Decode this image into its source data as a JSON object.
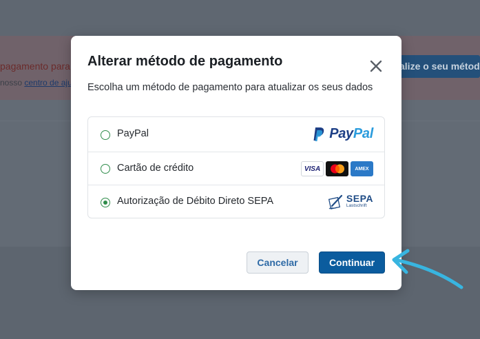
{
  "background": {
    "banner_text": "pagamento para c",
    "banner_link_prefix": "nosso ",
    "banner_link": "centro de aju",
    "banner_button": "alize o seu método"
  },
  "modal": {
    "title": "Alterar método de pagamento",
    "subtitle": "Escolha um método de pagamento para atualizar os seus dados",
    "close_icon": "close-icon",
    "options": [
      {
        "label": "PayPal",
        "selected": false,
        "logo": "paypal-logo",
        "logo_text_a": "Pay",
        "logo_text_b": "Pal"
      },
      {
        "label": "Cartão de crédito",
        "selected": false,
        "logos": [
          "VISA",
          "mastercard",
          "AMEX"
        ]
      },
      {
        "label": "Autorização de Débito Direto SEPA",
        "selected": true,
        "logo": "sepa-logo",
        "logo_text": "SEPA",
        "logo_subtext": "Lastschrift"
      }
    ],
    "cancel_label": "Cancelar",
    "continue_label": "Continuar"
  },
  "colors": {
    "radio_accent": "#2f8c4a",
    "primary_button": "#0b5c9e",
    "annotation_arrow": "#38b5e0"
  }
}
